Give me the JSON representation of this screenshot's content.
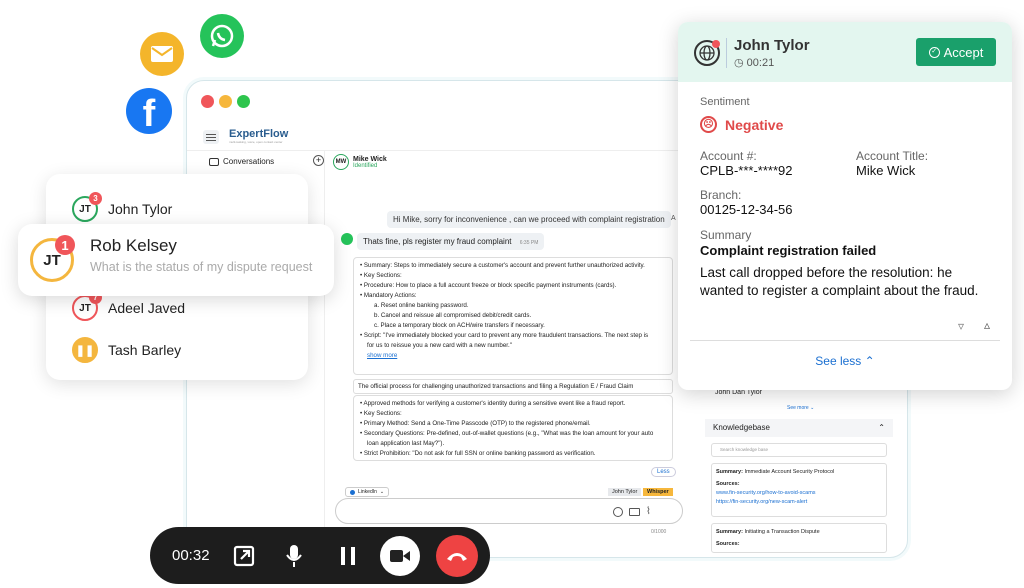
{
  "channels": {
    "email": "email-icon",
    "whatsapp": "whatsapp-icon",
    "facebook": "facebook-icon"
  },
  "app": {
    "logo": "ExpertFlow",
    "tagline": "multi-tasking, voice, open contact center"
  },
  "sidebar": {
    "title": "Conversations"
  },
  "chat": {
    "customer_initials": "MW",
    "customer_name": "Mike Wick",
    "customer_status": "Identified",
    "agent_msg": "Hi Mike, sorry for inconvenience , can we proceed with complaint registration",
    "agent_suffix": "A",
    "customer_msg": "Thats fine, pls register my fraud complaint",
    "customer_time": "6:35 PM",
    "card1": {
      "summary": "Summary: Steps to immediately secure a customer's account and prevent further unauthorized activity.",
      "key": "Key Sections:",
      "procedure": "Procedure: How to place a full account freeze or block specific payment instruments (cards).",
      "mandatory": "Mandatory Actions:",
      "a": "a. Reset online banking password.",
      "b": "b. Cancel and reissue all compromised debit/credit cards.",
      "c": "c. Place a temporary block on ACH/wire transfers if necessary.",
      "script1": "Script: \"I've immediately blocked your card to prevent any more fraudulent transactions. The next step is",
      "script2": "for us to reissue you a new card with a new number.\"",
      "show_more": "show more"
    },
    "process_line": "The official process for challenging unauthorized transactions and filing a Regulation E / Fraud Claim",
    "card2": {
      "l1": "Approved methods for verifying a customer's identity during a sensitive event like a fraud report.",
      "l2": "Key Sections:",
      "l3": "Primary Method: Send a One-Time Passcode (OTP) to the registered phone/email.",
      "l4": "Secondary Questions: Pre-defined, out-of-wallet questions (e.g., \"What was the loan amount for your auto",
      "l5": "loan application last May?\").",
      "l6": "Strict Prohibition: \"Do not ask for full SSN or online banking password as verification."
    },
    "less": "Less",
    "channel_select": "LinkedIn",
    "tab_agent": "John Tylor",
    "tab_whisper": "Whisper",
    "counter": "0/1000"
  },
  "right_panel": {
    "agent_name": "John Dan Tylor",
    "see_more": "See more",
    "kb_title": "Knowledgebase",
    "kb_search_placeholder": "Search knowledge base",
    "kb1_summary_label": "Summary:",
    "kb1_summary": "Immediate Account Security Protocol",
    "sources_label": "Sources:",
    "kb1_link1": "www.fin-security.org/how-to-avoid-scams",
    "kb1_link2": "https://fin-security.org/new-scam-alert",
    "kb2_summary": "Initiating a Transaction Dispute",
    "kb2_sources": "Sources:"
  },
  "conversations": [
    {
      "initials": "JT",
      "name": "John Tylor",
      "badge": "3",
      "color": "#2aa75d"
    },
    {
      "initials": "JT",
      "name": "Rob Kelsey",
      "badge": "1",
      "preview": "What is the status of my dispute request",
      "color": "#f4b63e"
    },
    {
      "initials": "JT",
      "name": "Adeel Javed",
      "badge": "7",
      "color": "#f0565a"
    },
    {
      "initials": "",
      "name": "Tash Barley",
      "badge": "",
      "color": "#f4b63e"
    }
  ],
  "popup": {
    "caller": "John Tylor",
    "timer": "00:21",
    "accept": "Accept",
    "sentiment_label": "Sentiment",
    "sentiment": "Negative",
    "account_no_label": "Account #:",
    "account_no": "CPLB-***-****92",
    "account_title_label": "Account Title:",
    "account_title": "Mike Wick",
    "branch_label": "Branch:",
    "branch": "00125-12-34-56",
    "summary_label": "Summary",
    "summary_title": "Complaint registration failed",
    "summary_text": "Last call dropped before the resolution: he wanted to register a complaint about the fraud.",
    "see_less": "See less",
    "accent": "#1aa06b",
    "header_bg": "#e3f6ef",
    "negative": "#e04a4a"
  },
  "callbar": {
    "time": "00:32"
  }
}
